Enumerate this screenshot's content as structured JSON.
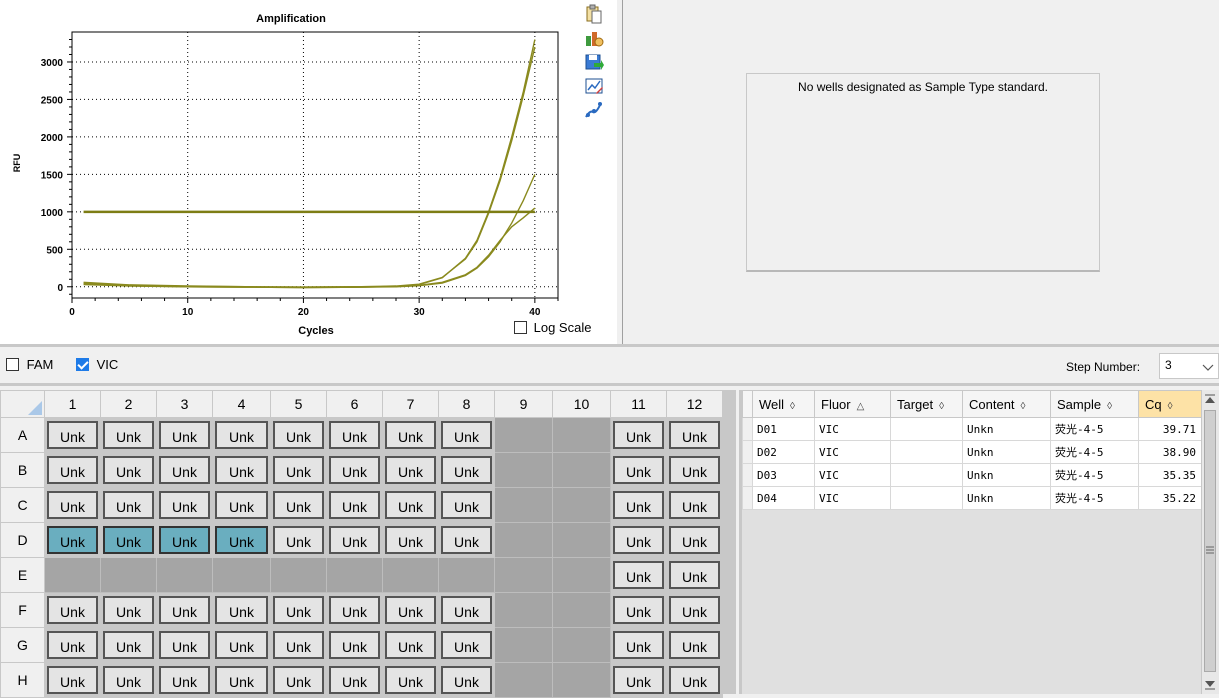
{
  "chart_panel": {
    "log_scale_label": "Log Scale",
    "toolbar_icons": [
      "copy-icon",
      "export-icon",
      "save-image-icon",
      "chart-settings-icon",
      "curve-icon"
    ]
  },
  "chart_data": {
    "type": "line",
    "title": "Amplification",
    "xlabel": "Cycles",
    "ylabel": "RFU",
    "xlim": [
      0,
      42
    ],
    "ylim": [
      -150,
      3400
    ],
    "xticks": [
      0,
      10,
      20,
      30,
      40
    ],
    "yticks": [
      0,
      500,
      1000,
      1500,
      2000,
      2500,
      3000
    ],
    "grid": true,
    "threshold": 1000,
    "line_color": "#8a8a1e",
    "series": [
      {
        "x": [
          1,
          5,
          10,
          15,
          20,
          25,
          28,
          30,
          32,
          34,
          35,
          36,
          37,
          38,
          39,
          40
        ],
        "values": [
          30,
          10,
          0,
          -5,
          -10,
          -5,
          5,
          30,
          120,
          380,
          620,
          1000,
          1450,
          2000,
          2600,
          3300
        ]
      },
      {
        "x": [
          1,
          5,
          10,
          15,
          20,
          25,
          28,
          30,
          32,
          34,
          35,
          36,
          37,
          38,
          39,
          40
        ],
        "values": [
          50,
          20,
          5,
          0,
          -5,
          0,
          10,
          35,
          125,
          370,
          600,
          980,
          1420,
          1950,
          2550,
          3200
        ]
      },
      {
        "x": [
          1,
          5,
          10,
          15,
          20,
          25,
          28,
          30,
          32,
          34,
          35,
          36,
          37,
          38,
          39,
          40
        ],
        "values": [
          40,
          15,
          0,
          -5,
          -10,
          -5,
          0,
          15,
          50,
          150,
          250,
          400,
          600,
          850,
          1150,
          1500
        ]
      },
      {
        "x": [
          1,
          5,
          10,
          15,
          20,
          25,
          28,
          30,
          32,
          34,
          35,
          36,
          37,
          38,
          39,
          40
        ],
        "values": [
          60,
          25,
          10,
          0,
          -5,
          0,
          5,
          20,
          60,
          160,
          260,
          420,
          620,
          800,
          920,
          1050
        ]
      }
    ]
  },
  "standard_curve": {
    "message": "No wells designated as Sample Type standard."
  },
  "fluor_filter": {
    "fam_label": "FAM",
    "fam_checked": false,
    "vic_label": "VIC",
    "vic_checked": true
  },
  "step": {
    "label": "Step Number:",
    "value": "3"
  },
  "plate": {
    "columns": [
      "1",
      "2",
      "3",
      "4",
      "5",
      "6",
      "7",
      "8",
      "9",
      "10",
      "11",
      "12"
    ],
    "rows": [
      {
        "label": "A",
        "wells": [
          "Unk",
          "Unk",
          "Unk",
          "Unk",
          "Unk",
          "Unk",
          "Unk",
          "Unk",
          "",
          "",
          "Unk",
          "Unk"
        ],
        "selected": []
      },
      {
        "label": "B",
        "wells": [
          "Unk",
          "Unk",
          "Unk",
          "Unk",
          "Unk",
          "Unk",
          "Unk",
          "Unk",
          "",
          "",
          "Unk",
          "Unk"
        ],
        "selected": []
      },
      {
        "label": "C",
        "wells": [
          "Unk",
          "Unk",
          "Unk",
          "Unk",
          "Unk",
          "Unk",
          "Unk",
          "Unk",
          "",
          "",
          "Unk",
          "Unk"
        ],
        "selected": []
      },
      {
        "label": "D",
        "wells": [
          "Unk",
          "Unk",
          "Unk",
          "Unk",
          "Unk",
          "Unk",
          "Unk",
          "Unk",
          "",
          "",
          "Unk",
          "Unk"
        ],
        "selected": [
          0,
          1,
          2,
          3
        ]
      },
      {
        "label": "E",
        "wells": [
          "",
          "",
          "",
          "",
          "",
          "",
          "",
          "",
          "",
          "",
          "Unk",
          "Unk"
        ],
        "selected": []
      },
      {
        "label": "F",
        "wells": [
          "Unk",
          "Unk",
          "Unk",
          "Unk",
          "Unk",
          "Unk",
          "Unk",
          "Unk",
          "",
          "",
          "Unk",
          "Unk"
        ],
        "selected": []
      },
      {
        "label": "G",
        "wells": [
          "Unk",
          "Unk",
          "Unk",
          "Unk",
          "Unk",
          "Unk",
          "Unk",
          "Unk",
          "",
          "",
          "Unk",
          "Unk"
        ],
        "selected": []
      },
      {
        "label": "H",
        "wells": [
          "Unk",
          "Unk",
          "Unk",
          "Unk",
          "Unk",
          "Unk",
          "Unk",
          "Unk",
          "",
          "",
          "Unk",
          "Unk"
        ],
        "selected": []
      }
    ]
  },
  "results": {
    "headers": [
      "Well",
      "Fluor",
      "Target",
      "Content",
      "Sample",
      "Cq"
    ],
    "sort_markers": [
      "◊",
      "△",
      "◊",
      "◊",
      "◊",
      "◊"
    ],
    "rows": [
      [
        "D01",
        "VIC",
        "",
        "Unkn",
        "荧光-4-5",
        "39.71"
      ],
      [
        "D02",
        "VIC",
        "",
        "Unkn",
        "荧光-4-5",
        "38.90"
      ],
      [
        "D03",
        "VIC",
        "",
        "Unkn",
        "荧光-4-5",
        "35.35"
      ],
      [
        "D04",
        "VIC",
        "",
        "Unkn",
        "荧光-4-5",
        "35.22"
      ]
    ]
  }
}
